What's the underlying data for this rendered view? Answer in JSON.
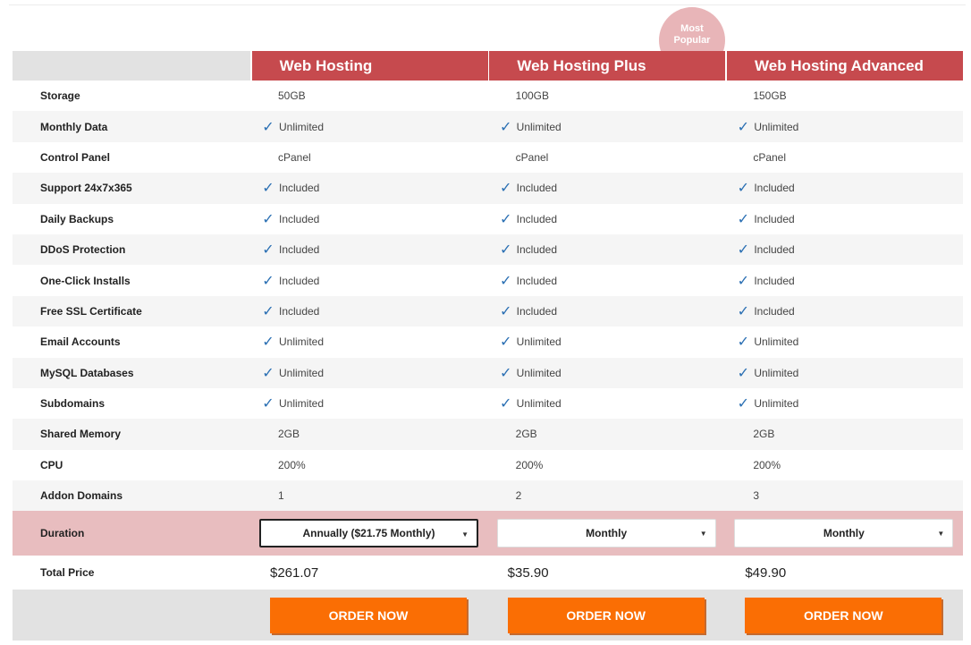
{
  "badge": {
    "line1": "Most",
    "line2": "Popular"
  },
  "plans": [
    "Web Hosting",
    "Web Hosting Plus",
    "Web Hosting Advanced"
  ],
  "features": [
    {
      "label": "Storage",
      "values": [
        "50GB",
        "100GB",
        "150GB"
      ],
      "check": [
        false,
        false,
        false
      ]
    },
    {
      "label": "Monthly Data",
      "values": [
        "Unlimited",
        "Unlimited",
        "Unlimited"
      ],
      "check": [
        true,
        true,
        true
      ]
    },
    {
      "label": "Control Panel",
      "values": [
        "cPanel",
        "cPanel",
        "cPanel"
      ],
      "check": [
        false,
        false,
        false
      ]
    },
    {
      "label": "Support 24x7x365",
      "values": [
        "Included",
        "Included",
        "Included"
      ],
      "check": [
        true,
        true,
        true
      ]
    },
    {
      "label": "Daily Backups",
      "values": [
        "Included",
        "Included",
        "Included"
      ],
      "check": [
        true,
        true,
        true
      ]
    },
    {
      "label": "DDoS Protection",
      "values": [
        "Included",
        "Included",
        "Included"
      ],
      "check": [
        true,
        true,
        true
      ]
    },
    {
      "label": "One-Click Installs",
      "values": [
        "Included",
        "Included",
        "Included"
      ],
      "check": [
        true,
        true,
        true
      ]
    },
    {
      "label": "Free SSL Certificate",
      "values": [
        "Included",
        "Included",
        "Included"
      ],
      "check": [
        true,
        true,
        true
      ]
    },
    {
      "label": "Email Accounts",
      "values": [
        "Unlimited",
        "Unlimited",
        "Unlimited"
      ],
      "check": [
        true,
        true,
        true
      ]
    },
    {
      "label": "MySQL Databases",
      "values": [
        "Unlimited",
        "Unlimited",
        "Unlimited"
      ],
      "check": [
        true,
        true,
        true
      ]
    },
    {
      "label": "Subdomains",
      "values": [
        "Unlimited",
        "Unlimited",
        "Unlimited"
      ],
      "check": [
        true,
        true,
        true
      ]
    },
    {
      "label": "Shared Memory",
      "values": [
        "2GB",
        "2GB",
        "2GB"
      ],
      "check": [
        false,
        false,
        false
      ]
    },
    {
      "label": "CPU",
      "values": [
        "200%",
        "200%",
        "200%"
      ],
      "check": [
        false,
        false,
        false
      ]
    },
    {
      "label": "Addon Domains",
      "values": [
        "1",
        "2",
        "3"
      ],
      "check": [
        false,
        false,
        false
      ]
    }
  ],
  "duration": {
    "label": "Duration",
    "selected": [
      "Annually ($21.75 Monthly)",
      "Monthly",
      "Monthly"
    ]
  },
  "total": {
    "label": "Total Price",
    "values": [
      "$261.07",
      "$35.90",
      "$49.90"
    ]
  },
  "order_label": "ORDER NOW",
  "colors": {
    "header": "#c64a4e",
    "badge": "#e8b5b8",
    "duration_row": "#e8bdbf",
    "button": "#fa6e04",
    "check": "#2a6fb3"
  },
  "icons": {
    "check": "check-icon",
    "caret": "caret-down-icon"
  }
}
